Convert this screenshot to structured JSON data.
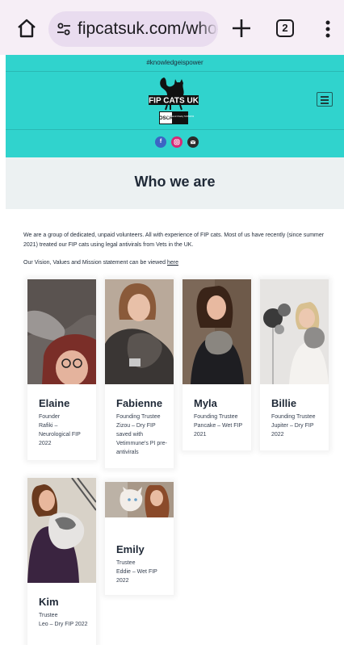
{
  "browser": {
    "url": "fipcatsuk.com/who-\\",
    "tab_count": "2",
    "icons": [
      "home-icon",
      "tune-icon",
      "plus-icon",
      "tabs-icon",
      "more-vert-icon"
    ]
  },
  "header": {
    "tagline": "#knowledgeispower",
    "logo_text": "FIP CATS UK",
    "oscr_text": "OSCR",
    "oscr_sub": "Registered Charity SC052152",
    "social": [
      "facebook-icon",
      "instagram-icon",
      "email-icon"
    ],
    "colors": {
      "teal": "#30d3cd",
      "facebook": "#3b66c4",
      "instagram": "#d62976",
      "email": "#2b2b2b"
    }
  },
  "page": {
    "title": "Who we are",
    "intro_p1": "We are a group of dedicated, unpaid volunteers. All with experience of FIP cats. Most of us have recently (since summer 2021) treated our FIP cats using legal antivirals from Vets in the UK.",
    "intro_p2": "Our Vision, Values and Mission statement can be viewed",
    "intro_link": "here"
  },
  "team": [
    {
      "name": "Elaine",
      "role": "Founder",
      "bio": "Rafiki – Neurological FIP 2022"
    },
    {
      "name": "Fabienne",
      "role": "Founding Trustee",
      "bio": "Zizou – Dry FIP saved with Vetimmune's PI pre-antivirals"
    },
    {
      "name": "Myla",
      "role": "Founding Trustee",
      "bio": "Pancake – Wet FIP 2021"
    },
    {
      "name": "Billie",
      "role": "Founding Trustee",
      "bio": "Jupiter – Dry FIP 2022"
    },
    {
      "name": "Kim",
      "role": "Trustee",
      "bio": "Leo – Dry FIP 2022"
    },
    {
      "name": "Emily",
      "role": "Trustee",
      "bio": "Eddie – Wet FIP 2022"
    }
  ]
}
